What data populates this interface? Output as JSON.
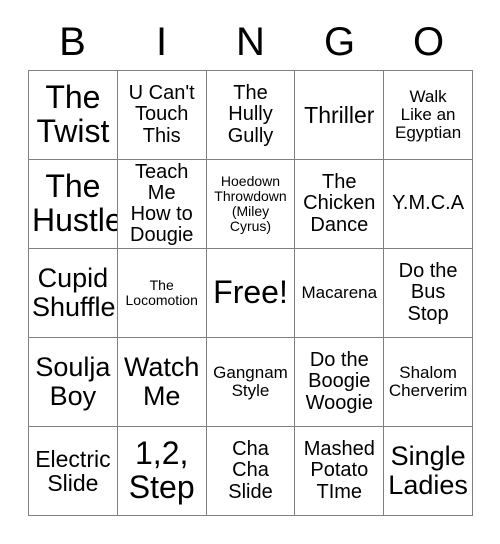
{
  "card": {
    "title_letters": [
      "B",
      "I",
      "N",
      "G",
      "O"
    ],
    "border_color": "#808080",
    "text_color": "#000000",
    "background_color": "#ffffff",
    "rows": 5,
    "columns": 5,
    "free_space_label": "Free!",
    "free_space_position": "row3-col3"
  },
  "squares": [
    {
      "row": 1,
      "col": 1,
      "text": "The\nTwist",
      "size": "xxl"
    },
    {
      "row": 1,
      "col": 2,
      "text": "U Can't\nTouch\nThis",
      "size": "m"
    },
    {
      "row": 1,
      "col": 3,
      "text": "The\nHully\nGully",
      "size": "m"
    },
    {
      "row": 1,
      "col": 4,
      "text": "Thriller",
      "size": "l"
    },
    {
      "row": 1,
      "col": 5,
      "text": "Walk\nLike an\nEgyptian",
      "size": "s"
    },
    {
      "row": 2,
      "col": 1,
      "text": "The\nHustle",
      "size": "xxl"
    },
    {
      "row": 2,
      "col": 2,
      "text": "Teach Me\nHow to\nDougie",
      "size": "m"
    },
    {
      "row": 2,
      "col": 3,
      "text": "Hoedown\nThrowdown\n(Miley\nCyrus)",
      "size": "xs"
    },
    {
      "row": 2,
      "col": 4,
      "text": "The\nChicken\nDance",
      "size": "m"
    },
    {
      "row": 2,
      "col": 5,
      "text": "Y.M.C.A",
      "size": "m"
    },
    {
      "row": 3,
      "col": 1,
      "text": "Cupid\nShuffle",
      "size": "xl"
    },
    {
      "row": 3,
      "col": 2,
      "text": "The\nLocomotion",
      "size": "xs"
    },
    {
      "row": 3,
      "col": 3,
      "text": "Free!",
      "size": "xxl"
    },
    {
      "row": 3,
      "col": 4,
      "text": "Macarena",
      "size": "s"
    },
    {
      "row": 3,
      "col": 5,
      "text": "Do the\nBus\nStop",
      "size": "m"
    },
    {
      "row": 4,
      "col": 1,
      "text": "Soulja\nBoy",
      "size": "xl"
    },
    {
      "row": 4,
      "col": 2,
      "text": "Watch\nMe",
      "size": "xl"
    },
    {
      "row": 4,
      "col": 3,
      "text": "Gangnam\nStyle",
      "size": "s"
    },
    {
      "row": 4,
      "col": 4,
      "text": "Do the\nBoogie\nWoogie",
      "size": "m"
    },
    {
      "row": 4,
      "col": 5,
      "text": "Shalom\nCherverim",
      "size": "s"
    },
    {
      "row": 5,
      "col": 1,
      "text": "Electric\nSlide",
      "size": "l"
    },
    {
      "row": 5,
      "col": 2,
      "text": "1,2,\nStep",
      "size": "xxl"
    },
    {
      "row": 5,
      "col": 3,
      "text": "Cha\nCha\nSlide",
      "size": "m"
    },
    {
      "row": 5,
      "col": 4,
      "text": "Mashed\nPotato\nTIme",
      "size": "m"
    },
    {
      "row": 5,
      "col": 5,
      "text": "Single\nLadies",
      "size": "xl"
    }
  ]
}
